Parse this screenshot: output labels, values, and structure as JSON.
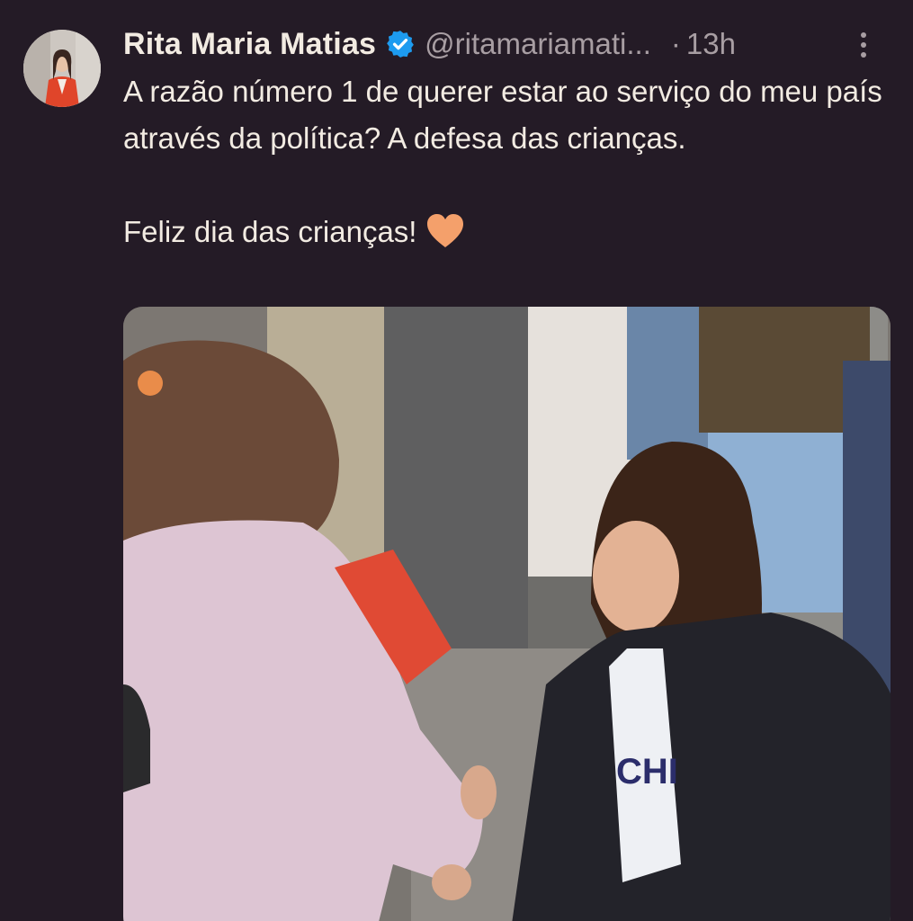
{
  "tweet": {
    "author_name": "Rita Maria Matias",
    "handle": "@ritamariamati...",
    "separator": "·",
    "time": "13h",
    "text_lines": [
      "A razão número 1 de querer estar ao serviço do meu país através da política? A defesa das crianças.",
      "Feliz dia das crianças!"
    ],
    "emoji": "orange-heart-icon",
    "shirt_text": "CHI"
  },
  "icons": {
    "verified": "verified-badge-icon",
    "more": "more-vertical-icon"
  },
  "colors": {
    "background": "#241b26",
    "text": "#f2ebe2",
    "secondary_text": "#a89ea3",
    "verified_blue": "#1d9bf0",
    "heart_orange": "#f4a06b"
  }
}
